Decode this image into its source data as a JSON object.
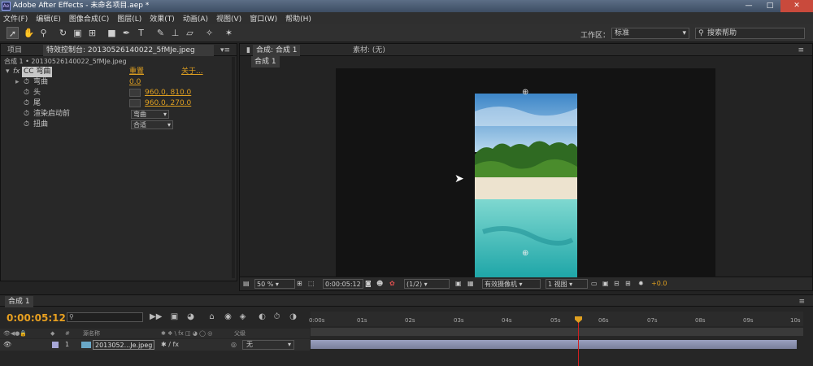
{
  "window": {
    "title": "Adobe After Effects - 未命名项目.aep *",
    "app_icon": "Ae",
    "min": "—",
    "max": "□",
    "close": "✕"
  },
  "menu": [
    "文件(F)",
    "编辑(E)",
    "图像合成(C)",
    "图层(L)",
    "效果(T)",
    "动画(A)",
    "视图(V)",
    "窗口(W)",
    "帮助(H)"
  ],
  "toolbar": {
    "workspace_label": "工作区：",
    "workspace_value": "标准",
    "search_placeholder": "搜索帮助"
  },
  "left_panel": {
    "tab_project": "项目",
    "tab_effects": "特效控制台: 20130526140022_5fMJe.jpeg",
    "subtitle": "合成 1 • 20130526140022_5fMJe.jpeg",
    "effect": {
      "fx": "fx",
      "name": "CC 弯曲",
      "reset": "重置",
      "about": "关于..."
    },
    "props": [
      {
        "label": "弯曲",
        "value": "0.0"
      },
      {
        "label": "头",
        "value": "960.0, 810.0"
      },
      {
        "label": "尾",
        "value": "960.0, 270.0"
      },
      {
        "label": "渲染启动前",
        "value": "弯曲"
      },
      {
        "label": "扭曲",
        "value": "合适"
      }
    ]
  },
  "viewer": {
    "tab_comp": "合成: 合成 1",
    "tab_footage": "素材: (无)",
    "subtab": "合成 1",
    "zoom": "50 %",
    "timecode": "0:00:05:12",
    "resolution": "(1/2)",
    "camera": "有效摄像机",
    "views": "1 视图",
    "exposure": "+0.0"
  },
  "timeline": {
    "tab": "合成 1",
    "timecode": "0:00:05:12",
    "col_source": "源名称",
    "col_parent": "父级",
    "ruler": [
      "0:00s",
      "01s",
      "02s",
      "03s",
      "04s",
      "05s",
      "06s",
      "07s",
      "08s",
      "09s",
      "10s"
    ],
    "layer": {
      "index": "1",
      "name": "2013052...Je.jpeg",
      "parent": "无"
    }
  }
}
